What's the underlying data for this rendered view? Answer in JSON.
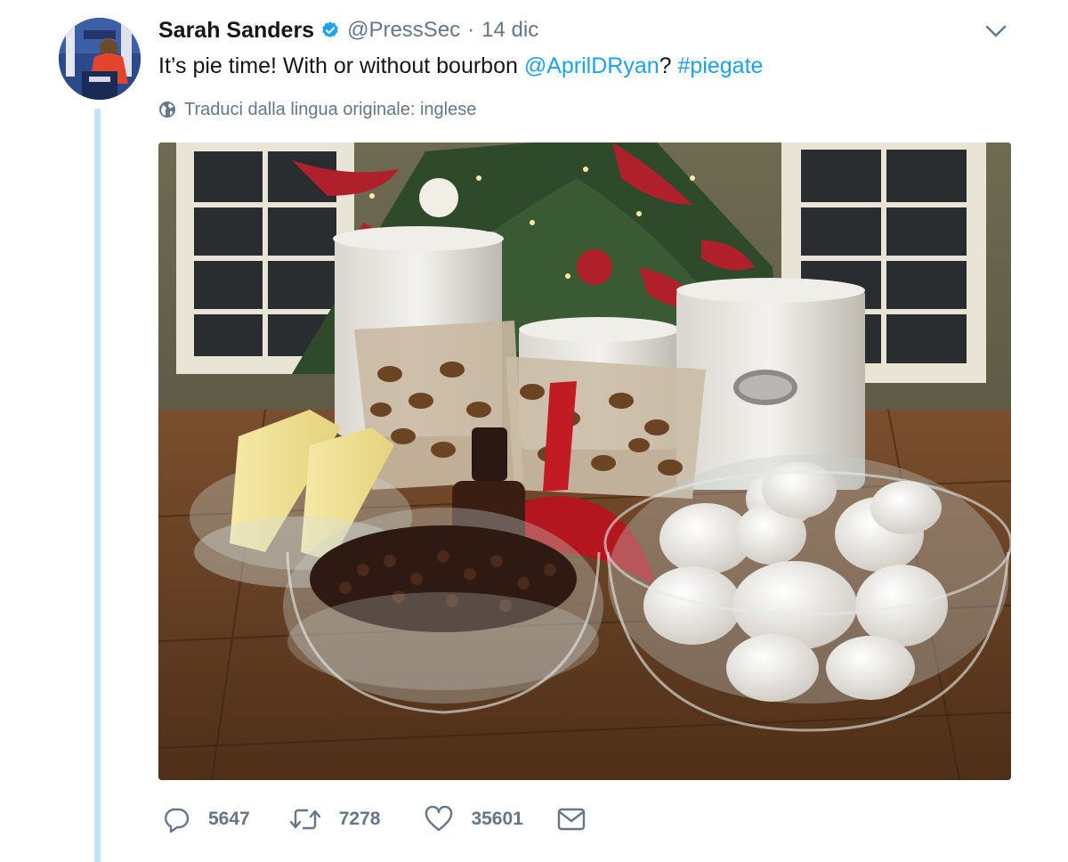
{
  "tweet": {
    "author_name": "Sarah Sanders",
    "handle": "@PressSec",
    "separator": "·",
    "timestamp": "14 dic",
    "text_start": "It’s pie time! With or without bourbon ",
    "mention": "@AprilDRyan",
    "text_mid": "? ",
    "hashtag": "#piegate",
    "translate_label": "Traduci dalla lingua originale: inglese",
    "verified": true
  },
  "actions": {
    "reply_count": "5647",
    "retweet_count": "7278",
    "like_count": "35601"
  },
  "icons": {
    "verified": "verified-badge-icon",
    "caret": "chevron-down-icon",
    "translate": "globe-icon",
    "reply": "reply-icon",
    "retweet": "retweet-icon",
    "like": "heart-icon",
    "dm": "envelope-icon"
  },
  "colors": {
    "link": "#1da1f2",
    "muted": "#657786",
    "thread_line": "#c4e2f8",
    "text": "#14171a"
  }
}
